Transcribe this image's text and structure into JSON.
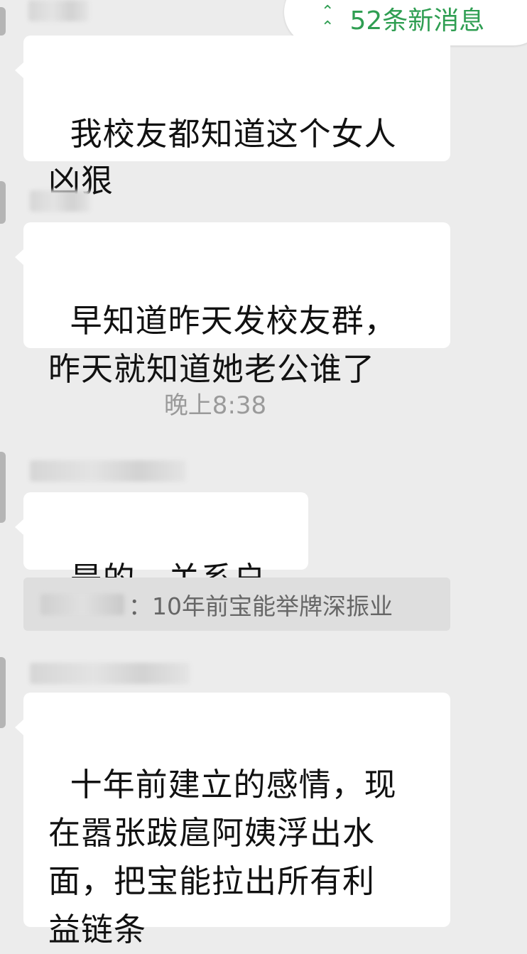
{
  "messages": [
    {
      "text": "我校友都知道这个女人\n凶狠"
    },
    {
      "text": "早知道昨天发校友群，\n昨天就知道她老公谁了"
    },
    {
      "text": "是的，关系户。"
    },
    {
      "text": "十年前建立的感情，现\n在嚣张跋扈阿姨浮出水\n面，把宝能拉出所有利\n益链条"
    }
  ],
  "timestamp": "晚上8:38",
  "quote": {
    "text": "：10年前宝能举牌深振业"
  },
  "new_messages": {
    "icon": "double-chevron-up-icon",
    "label": "52条新消息",
    "color": "#2f9e52"
  }
}
